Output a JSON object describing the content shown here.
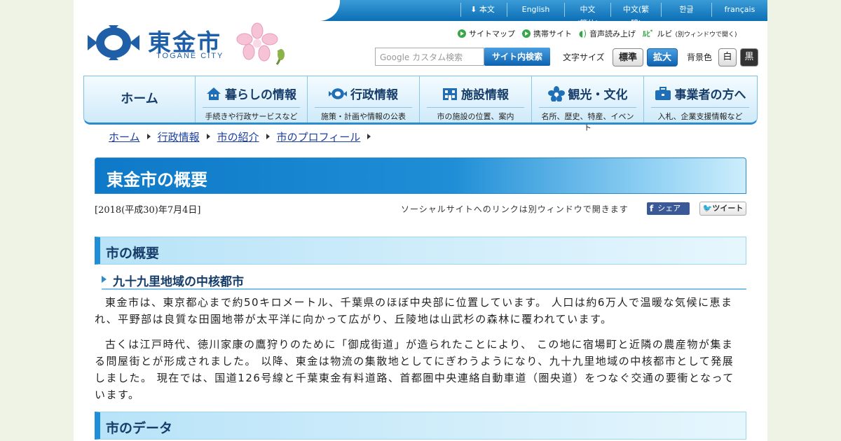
{
  "topbar": {
    "links": [
      "本文へ",
      "English",
      "中文(簡体)",
      "中文(繁體)",
      "한글",
      "français"
    ]
  },
  "logo": {
    "name": "東金市",
    "sub": "TOGANE CITY"
  },
  "utility": {
    "sitemap": "サイトマップ",
    "mobile": "携帯サイト",
    "voice": "音声読み上げ",
    "ruby": "ルビ",
    "ruby_note": "(別ウィンドウで開く)"
  },
  "search": {
    "placeholder": "Google カスタム検索",
    "button": "サイト内検索"
  },
  "font_size": {
    "label": "文字サイズ",
    "standard": "標準",
    "large": "拡大"
  },
  "bg_color": {
    "label": "背景色",
    "white": "白",
    "black": "黒"
  },
  "nav": {
    "home": "ホーム",
    "items": [
      {
        "title": "暮らしの情報",
        "sub": "手続きや行政サービスなど"
      },
      {
        "title": "行政情報",
        "sub": "施策・計画や情報の公表"
      },
      {
        "title": "施設情報",
        "sub": "市の施設の位置、案内"
      },
      {
        "title": "観光・文化",
        "sub": "名所、歴史、特産、イベント"
      },
      {
        "title": "事業者の方へ",
        "sub": "入札、企業支援情報など"
      }
    ]
  },
  "breadcrumb": [
    "ホーム",
    "行政情報",
    "市の紹介",
    "市のプロフィール"
  ],
  "page": {
    "title": "東金市の概要",
    "date": "[2018(平成30)年7月4日]",
    "social_note": "ソーシャルサイトへのリンクは別ウィンドウで開きます",
    "share": "シェア",
    "tweet": "ツイート"
  },
  "sections": {
    "overview_heading": "市の概要",
    "sub_heading": "九十九里地域の中核都市",
    "para1": "東金市は、東京都心まで約50キロメートル、千葉県のほぼ中央部に位置しています。 人口は約6万人で温暖な気候に恵まれ、平野部は良質な田園地帯が太平洋に向かって広がり、丘陵地は山武杉の森林に覆われています。",
    "para2": "古くは江戸時代、徳川家康の鷹狩りのために「御成街道」が造られたことにより、 この地に宿場町と近隣の農産物が集まる問屋街とが形成されました。 以降、東金は物流の集散地としてにぎわうようになり、九十九里地域の中核都市として発展しました。 現在では、国道126号線と千葉東金有料道路、首都圏中央連絡自動車道（圏央道）をつなぐ交通の要衝となっています。",
    "data_heading": "市のデータ"
  }
}
